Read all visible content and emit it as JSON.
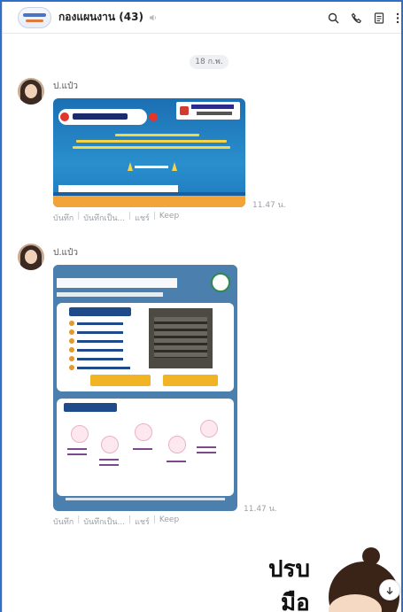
{
  "header": {
    "group_name": "กองแผนงาน (43)",
    "icons": [
      "search-icon",
      "phone-icon",
      "notes-icon",
      "more-icon"
    ]
  },
  "chat": {
    "date_label": "18 ก.พ.",
    "messages": [
      {
        "sender": "ป.แป๋ว",
        "time": "11.47 น.",
        "actions": [
          "บันทึก",
          "บันทึกเป็น...",
          "แชร์",
          "Keep"
        ]
      },
      {
        "sender": "ป.แป๋ว",
        "time": "11.47 น.",
        "actions": [
          "บันทึก",
          "บันทึกเป็น...",
          "แชร์",
          "Keep"
        ]
      }
    ],
    "sticker": {
      "text_line1": "ปรบ",
      "text_line2": "มือ"
    }
  },
  "colors": {
    "accent": "#2f6fc9",
    "time_text": "#9aa0a8"
  }
}
